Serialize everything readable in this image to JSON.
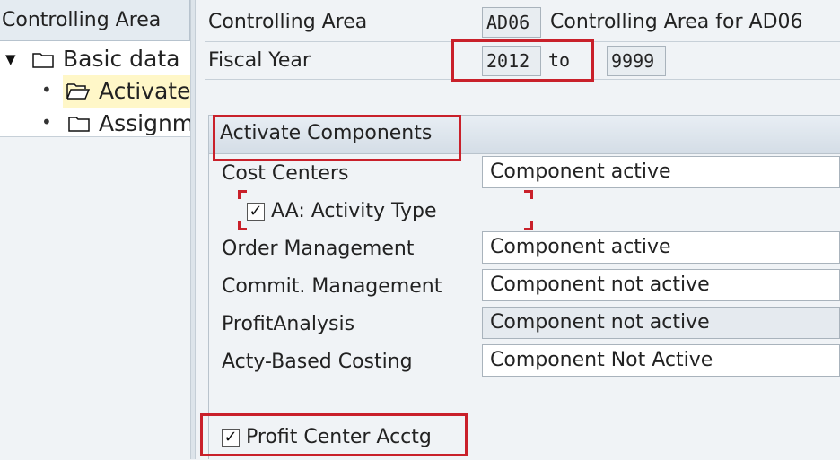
{
  "nav": {
    "header": "Controlling Area",
    "items": [
      {
        "label": "Basic data"
      },
      {
        "label": "Activate"
      },
      {
        "label": "Assignm"
      }
    ]
  },
  "header": {
    "controlling_area_label": "Controlling Area",
    "controlling_area_value": "AD06",
    "controlling_area_desc": "Controlling Area for AD06",
    "fiscal_year_label": "Fiscal Year",
    "fiscal_year_from": "2012",
    "to_label": "to",
    "fiscal_year_to": "9999"
  },
  "components": {
    "title": "Activate Components",
    "rows": [
      {
        "label": "Cost Centers",
        "value": "Component active"
      },
      {
        "label": "Order Management",
        "value": "Component active"
      },
      {
        "label": "Commit. Management",
        "value": "Component not active"
      },
      {
        "label": "ProfitAnalysis",
        "value": "Component not active"
      },
      {
        "label": "Acty-Based Costing",
        "value": "Component Not Active"
      }
    ],
    "activity_type": {
      "label": "AA: Activity Type",
      "checked": true
    },
    "profit_center": {
      "label": "Profit Center Acctg",
      "checked": true
    }
  },
  "colors": {
    "highlight": "#c9202a",
    "selected_row": "#fff7c8"
  }
}
